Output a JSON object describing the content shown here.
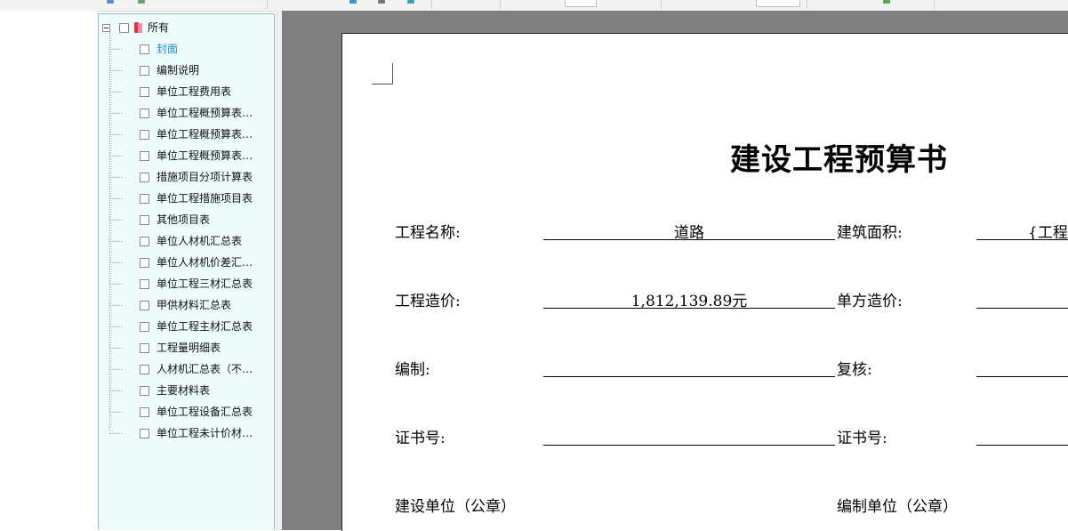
{
  "tree": {
    "root_label": "所有",
    "items": [
      {
        "label": "封面",
        "selected": true
      },
      {
        "label": "编制说明"
      },
      {
        "label": "单位工程费用表"
      },
      {
        "label": "单位工程概预算表…"
      },
      {
        "label": "单位工程概预算表…"
      },
      {
        "label": "单位工程概预算表…"
      },
      {
        "label": "措施项目分项计算表"
      },
      {
        "label": "单位工程措施项目表"
      },
      {
        "label": "其他项目表"
      },
      {
        "label": "单位人材机汇总表"
      },
      {
        "label": "单位人材机价差汇…"
      },
      {
        "label": "单位工程三材汇总表"
      },
      {
        "label": "甲供材料汇总表"
      },
      {
        "label": "单位工程主材汇总表"
      },
      {
        "label": "工程量明细表"
      },
      {
        "label": "人材机汇总表（不…"
      },
      {
        "label": "主要材料表"
      },
      {
        "label": "单位工程设备汇总表"
      },
      {
        "label": "单位工程未计价材…"
      }
    ]
  },
  "document": {
    "title": "建设工程预算书",
    "project_name_label": "工程名称:",
    "project_name_value": "道路",
    "building_area_label": "建筑面积:",
    "building_area_value": "{工程",
    "project_cost_label": "工程造价:",
    "project_cost_value": "1,812,139.89元",
    "unit_cost_label": "单方造价:",
    "compiler_label": "编制:",
    "reviewer_label": "复核:",
    "cert_no_label_left": "证书号:",
    "cert_no_label_right": "证书号:",
    "construction_unit_label": "建设单位（公章）",
    "compiling_unit_label": "编制单位（公章）"
  }
}
